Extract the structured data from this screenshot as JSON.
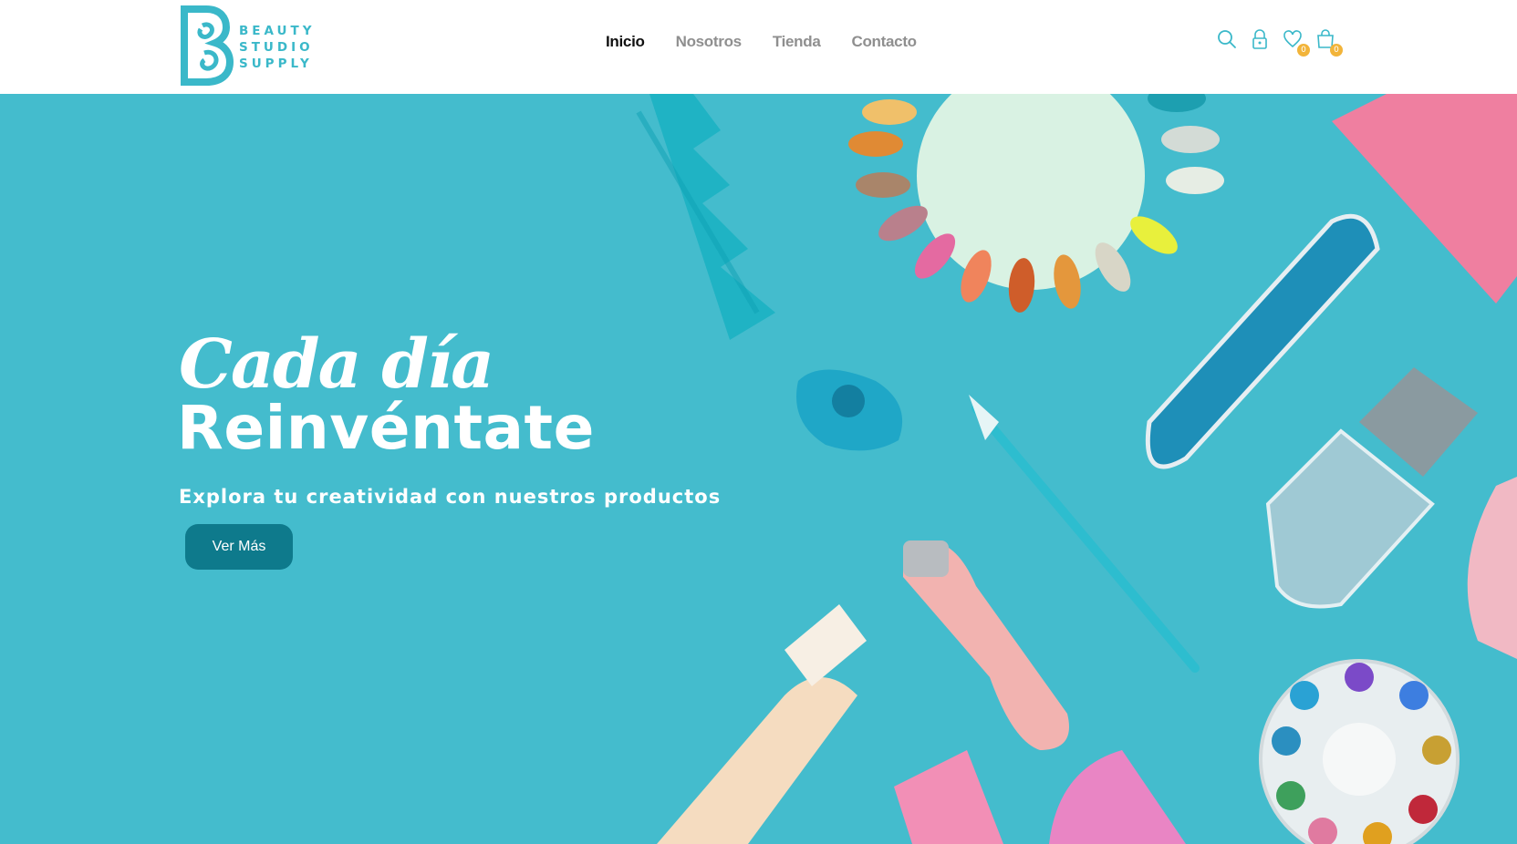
{
  "brand": {
    "logo_lines": [
      "BEAUTY",
      "STUDIO",
      "SUPPLY"
    ],
    "logo_letter": "B",
    "color": "#3ab8c9"
  },
  "nav": {
    "items": [
      {
        "label": "Inicio",
        "active": true
      },
      {
        "label": "Nosotros",
        "active": false
      },
      {
        "label": "Tienda",
        "active": false
      },
      {
        "label": "Contacto",
        "active": false
      }
    ]
  },
  "header_icons": {
    "search_icon": "search-icon",
    "account_icon": "lock-icon",
    "wishlist_icon": "heart-icon",
    "wishlist_count": "0",
    "cart_icon": "shopping-bag-icon",
    "cart_count": "0",
    "badge_color": "#f2b43a"
  },
  "hero": {
    "title_line1": "Cada día",
    "title_line2": "Reinvéntate",
    "subtitle": "Explora tu creatividad con nuestros productos",
    "cta_label": "Ver Más",
    "background_color": "#44bccd",
    "cta_color": "#0e7a8c"
  }
}
